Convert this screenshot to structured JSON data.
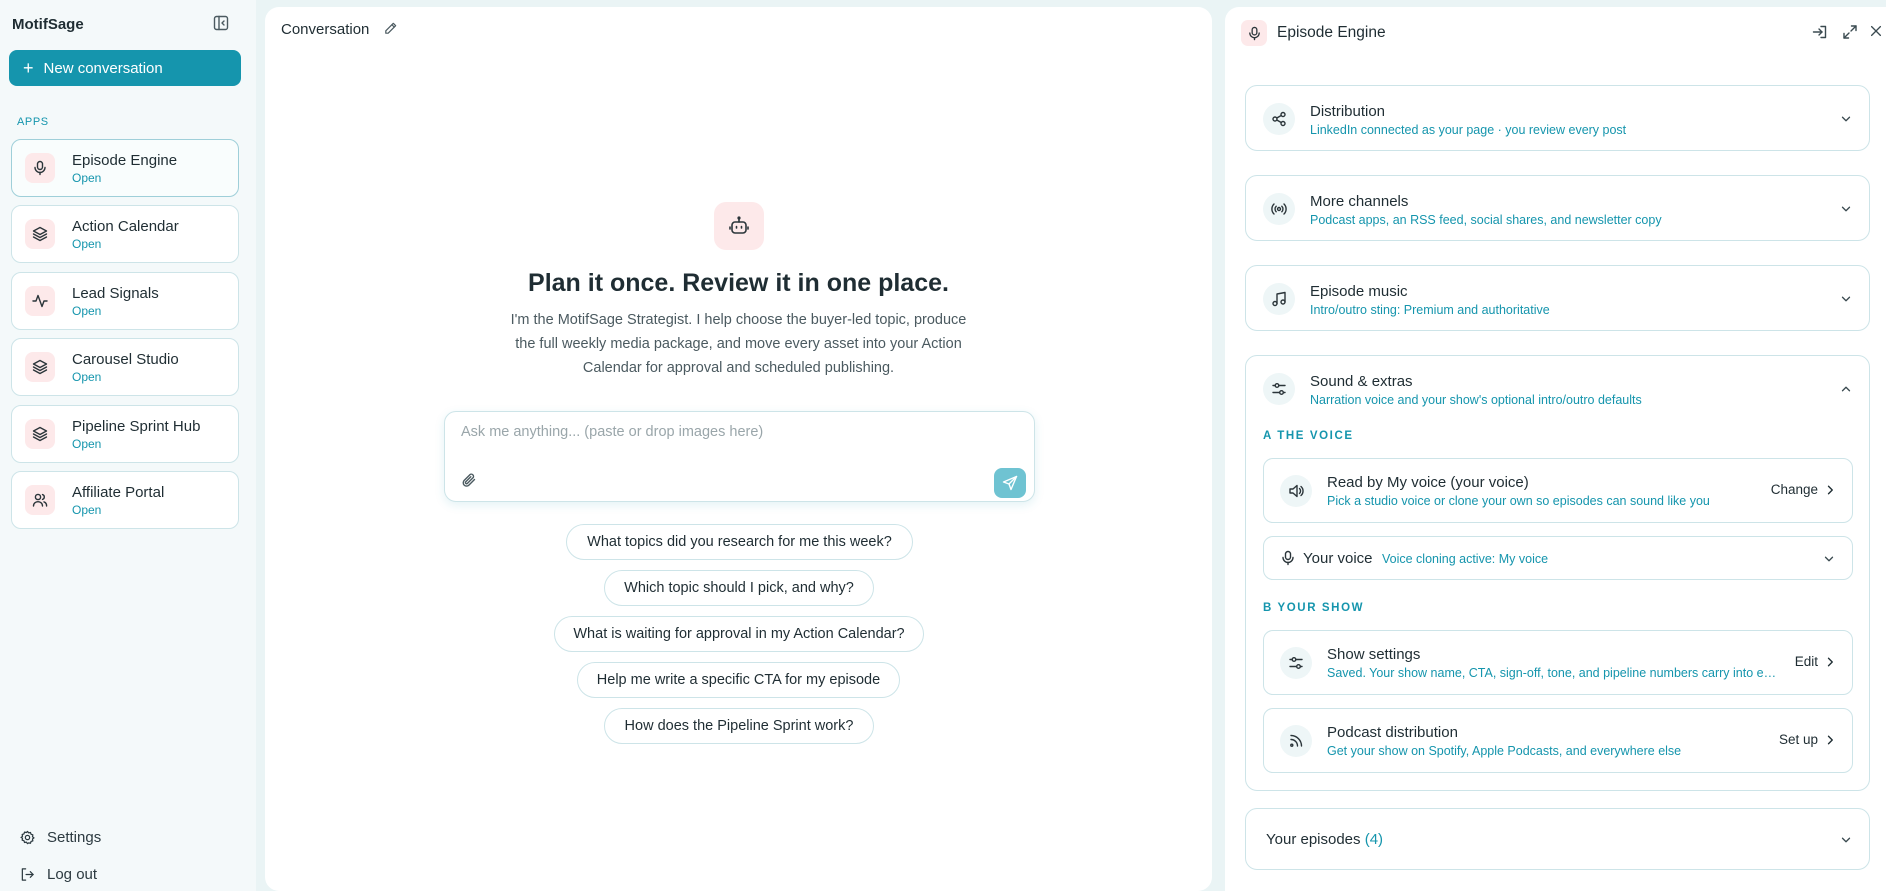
{
  "sidebar": {
    "brand": "MotifSage",
    "new_conversation": "New conversation",
    "apps_label": "APPS",
    "apps": [
      {
        "name": "Episode Engine",
        "status": "Open",
        "icon": "microphone-icon"
      },
      {
        "name": "Action Calendar",
        "status": "Open",
        "icon": "layers-icon"
      },
      {
        "name": "Lead Signals",
        "status": "Open",
        "icon": "activity-icon"
      },
      {
        "name": "Carousel Studio",
        "status": "Open",
        "icon": "layers-icon"
      },
      {
        "name": "Pipeline Sprint Hub",
        "status": "Open",
        "icon": "layers-icon"
      },
      {
        "name": "Affiliate Portal",
        "status": "Open",
        "icon": "users-icon"
      }
    ],
    "settings": "Settings",
    "logout": "Log out"
  },
  "conversation": {
    "title": "Conversation",
    "headline": "Plan it once. Review it in one place.",
    "intro": "I'm the MotifSage Strategist. I help choose the buyer-led topic, produce the full weekly media package, and move every asset into your Action Calendar for approval and scheduled publishing.",
    "input_placeholder": "Ask me anything... (paste or drop images here)",
    "suggestions": [
      "What topics did you research for me this week?",
      "Which topic should I pick, and why?",
      "What is waiting for approval in my Action Calendar?",
      "Help me write a specific CTA for my episode",
      "How does the Pipeline Sprint work?"
    ]
  },
  "panel": {
    "title": "Episode Engine",
    "sections": [
      {
        "title": "Distribution",
        "subtitle": "LinkedIn connected as your page · you review every post",
        "icon": "share-icon"
      },
      {
        "title": "More channels",
        "subtitle": "Podcast apps, an RSS feed, social shares, and newsletter copy",
        "icon": "broadcast-icon"
      },
      {
        "title": "Episode music",
        "subtitle": "Intro/outro sting: Premium and authoritative",
        "icon": "music-note-icon"
      },
      {
        "title": "Sound & extras",
        "subtitle": "Narration voice and your show's optional intro/outro defaults",
        "icon": "sliders-icon"
      }
    ],
    "voice_label": "A  THE VOICE",
    "voice_row": {
      "title": "Read by My voice (your voice)",
      "subtitle": "Pick a studio voice or clone your own so episodes can sound like you",
      "action": "Change"
    },
    "your_voice": {
      "label": "Your voice",
      "status": "Voice cloning active: My voice"
    },
    "show_label": "B  YOUR SHOW",
    "show_settings": {
      "title": "Show settings",
      "subtitle": "Saved. Your show name, CTA, sign-off, tone, and pipeline numbers carry into every episode.",
      "action": "Edit"
    },
    "podcast_distribution": {
      "title": "Podcast distribution",
      "subtitle": "Get your show on Spotify, Apple Podcasts, and everywhere else",
      "action": "Set up"
    },
    "episodes_label": "Your episodes",
    "episodes_count": "(4)"
  },
  "colors": {
    "accent": "#1595ad",
    "icon_tile": "#fde9ea",
    "border": "#cde4e8",
    "background": "#eaf4f5"
  }
}
